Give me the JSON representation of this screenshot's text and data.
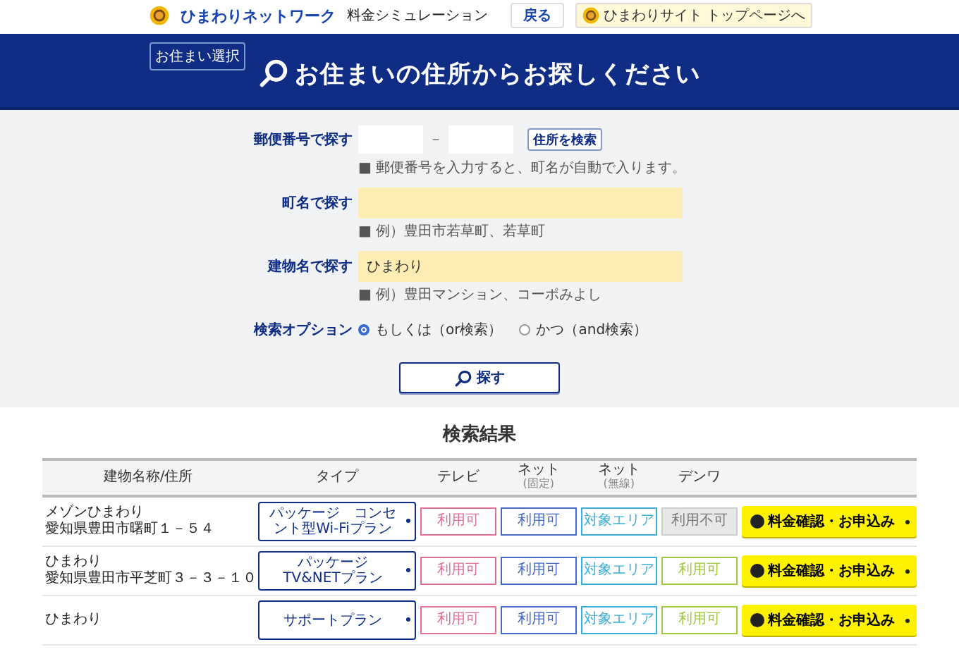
{
  "header": {
    "logo_text": "ひまわりネットワーク",
    "title": "料金シミュレーション",
    "buttons": [
      {
        "label": "戻る",
        "kind": "plain"
      },
      {
        "label": "ひまわりサイト トップページへ",
        "kind": "home"
      }
    ]
  },
  "banner": {
    "back_label": "お住まい選択",
    "heading": "お住まいの住所からお探しください"
  },
  "form": {
    "fields": [
      {
        "kind": "postal",
        "label": "郵便番号で探す",
        "separator": "－",
        "button": "住所を検索",
        "hint": "■ 郵便番号を入力すると、町名が自動で入ります。"
      },
      {
        "kind": "text",
        "label": "町名で探す",
        "hint": "■ 例）豊田市若草町、若草町"
      },
      {
        "kind": "text",
        "label": "建物名で探す",
        "value": "ひまわり",
        "hint": "■ 例）豊田マンション、コーポみよし"
      },
      {
        "kind": "radio",
        "label": "検索オプション",
        "options": [
          {
            "label": "もしくは（or検索）",
            "selected": true
          },
          {
            "label": "かつ（and検索）",
            "selected": false
          }
        ]
      }
    ],
    "search_button": "探す"
  },
  "results": {
    "title": "検索結果",
    "columns": [
      {
        "label": "建物名称/住所"
      },
      {
        "label": "タイプ"
      },
      {
        "label": "テレビ"
      },
      {
        "label": "ネット",
        "note": "(固定)"
      },
      {
        "label": "ネット",
        "note": "(無線)"
      },
      {
        "label": "デンワ"
      }
    ],
    "rows": [
      {
        "name": "メゾンひまわり",
        "address": "愛知県豊田市曙町１－５４",
        "plan": "パッケージ　コンセント型Wi-Fiプラン",
        "services": [
          {
            "text": "利用可",
            "available": true,
            "color": "#e0709a"
          },
          {
            "text": "利用可",
            "available": true,
            "color": "#4466cc"
          },
          {
            "text": "対象エリア",
            "available": true,
            "color": "#3ab0d8"
          },
          {
            "text": "利用不可",
            "available": false
          }
        ],
        "action": "料金確認・お申込み"
      },
      {
        "name": "ひまわり",
        "address": "愛知県豊田市平芝町３－３－１０",
        "plan": "パッケージ　TV&NETプラン",
        "services": [
          {
            "text": "利用可",
            "available": true,
            "color": "#e0709a"
          },
          {
            "text": "利用可",
            "available": true,
            "color": "#4466cc"
          },
          {
            "text": "対象エリア",
            "available": true,
            "color": "#3ab0d8"
          },
          {
            "text": "利用可",
            "available": true,
            "color": "#a0c840"
          }
        ],
        "action": "料金確認・お申込み"
      },
      {
        "name": "ひまわり",
        "plan": "サポートプラン",
        "services": [
          {
            "text": "利用可",
            "available": true,
            "color": "#e0709a"
          },
          {
            "text": "利用可",
            "available": true,
            "color": "#4466cc"
          },
          {
            "text": "対象エリア",
            "available": true,
            "color": "#3ab0d8"
          },
          {
            "text": "利用可",
            "available": true,
            "color": "#a0c840"
          }
        ],
        "action": "料金確認・お申込み"
      }
    ]
  }
}
